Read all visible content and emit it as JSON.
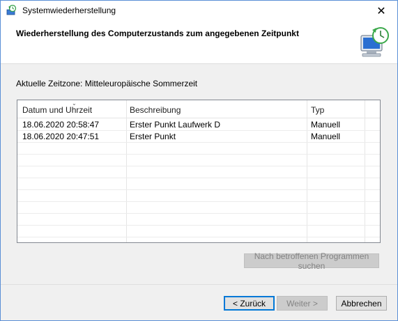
{
  "window": {
    "title": "Systemwiederherstellung",
    "close_glyph": "✕"
  },
  "header": {
    "title": "Wiederherstellung des Computerzustands zum angegebenen Zeitpunkt"
  },
  "timezone_text": "Aktuelle Zeitzone: Mitteleuropäische Sommerzeit",
  "table": {
    "columns": [
      "Datum und Uhrzeit",
      "Beschreibung",
      "Typ"
    ],
    "rows": [
      [
        "18.06.2020 20:58:47",
        "Erster Punkt Laufwerk D",
        "Manuell"
      ],
      [
        "18.06.2020 20:47:51",
        "Erster Punkt",
        "Manuell"
      ]
    ]
  },
  "buttons": {
    "scan": "Nach betroffenen Programmen suchen",
    "back": "< Zurück",
    "next": "Weiter >",
    "cancel": "Abbrechen"
  },
  "icons": {
    "app": "system-restore-icon",
    "header": "restore-computer-icon"
  }
}
